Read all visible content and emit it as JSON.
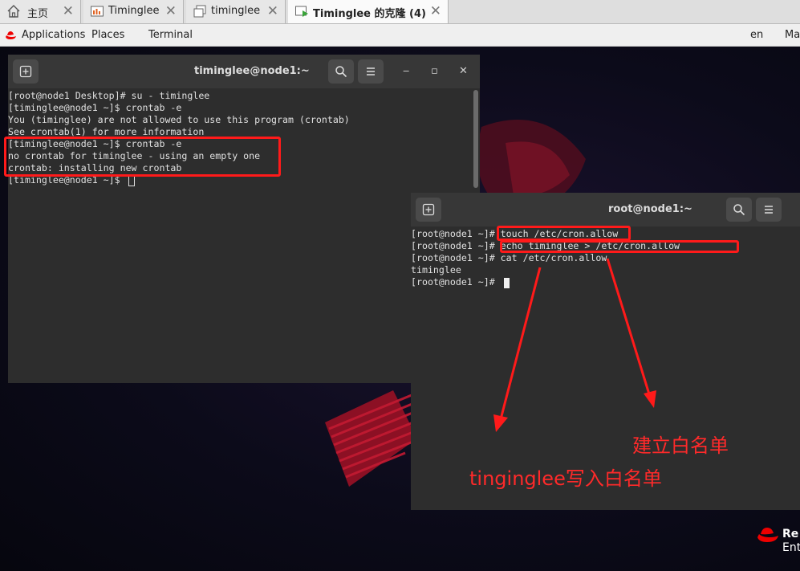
{
  "vm_tabs": [
    {
      "label": "主页",
      "icon": "home-icon",
      "active": false
    },
    {
      "label": "Timinglee",
      "icon": "vm-icon",
      "active": false
    },
    {
      "label": "timinglee",
      "icon": "clone-icon",
      "active": false
    },
    {
      "label": "Timinglee 的克隆 (4)",
      "icon": "vm-running-icon",
      "active": true
    }
  ],
  "tab_close_glyph": "✕",
  "topbar": {
    "applications": "Applications",
    "places": "Places",
    "terminal": "Terminal",
    "lang": "en",
    "clock": "Ma"
  },
  "window_controls": {
    "minimize": "‒",
    "maximize": "▫",
    "close": "✕"
  },
  "terminal_left": {
    "title": "timinglee@node1:~",
    "lines": [
      "[root@node1 Desktop]# su - timinglee",
      "[timinglee@node1 ~]$ crontab -e",
      "You (timinglee) are not allowed to use this program (crontab)",
      "See crontab(1) for more information",
      "[timinglee@node1 ~]$ crontab -e",
      "no crontab for timinglee - using an empty one",
      "crontab: installing new crontab",
      "[timinglee@node1 ~]$ "
    ]
  },
  "terminal_right": {
    "title": "root@node1:~",
    "lines": [
      "[root@node1 ~]# touch /etc/cron.allow",
      "[root@node1 ~]# echo timinglee > /etc/cron.allow",
      "[root@node1 ~]# cat /etc/cron.allow",
      "timinglee",
      "[root@node1 ~]# "
    ]
  },
  "annotations": {
    "create_whitelist": "建立白名单",
    "write_whitelist": "tinginglee写入白名单"
  },
  "branding": {
    "line1": "Re",
    "line2": "Ent"
  },
  "colors": {
    "annotation": "#ff1a1a",
    "terminal_bg": "#2d2d2d",
    "brand_red": "#ee0000"
  }
}
